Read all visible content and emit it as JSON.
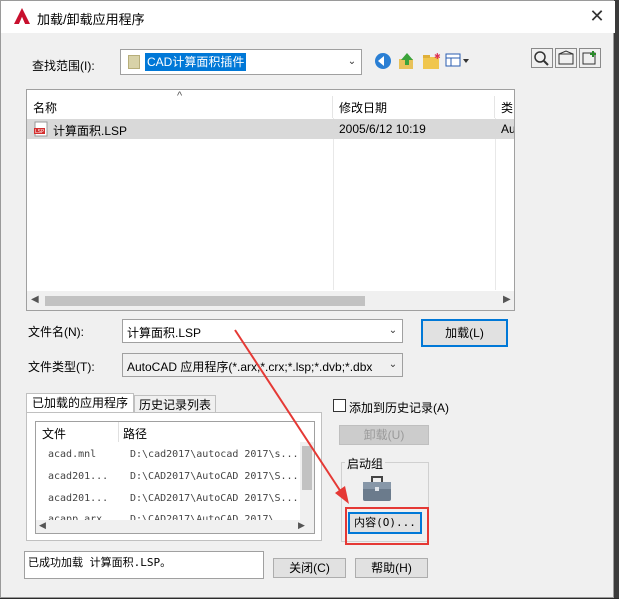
{
  "dialog": {
    "title": "加载/卸载应用程序"
  },
  "lookin": {
    "label": "查找范围(I):",
    "value": "CAD计算面积插件"
  },
  "filelist": {
    "columns": [
      "名称",
      "修改日期",
      "类"
    ],
    "rows": [
      {
        "name": "计算面积.LSP",
        "date": "2005/6/12 10:19",
        "type": "Au"
      }
    ]
  },
  "filename": {
    "label": "文件名(N):",
    "value": "计算面积.LSP"
  },
  "filetype": {
    "label": "文件类型(T):",
    "value": "AutoCAD 应用程序(*.arx;*.crx;*.lsp;*.dvb;*.dbx"
  },
  "buttons": {
    "load": "加载(L)",
    "unload": "卸载(U)",
    "contents": "内容(O)...",
    "close": "关闭(C)",
    "help": "帮助(H)"
  },
  "tabs": [
    "已加载的应用程序",
    "历史记录列表"
  ],
  "loaded": {
    "columns": [
      "文件",
      "路径"
    ],
    "rows": [
      {
        "file": "acad.mnl",
        "path": "D:\\cad2017\\autocad 2017\\s..."
      },
      {
        "file": "acad201...",
        "path": "D:\\CAD2017\\AutoCAD 2017\\S..."
      },
      {
        "file": "acad201...",
        "path": "D:\\CAD2017\\AutoCAD 2017\\S..."
      },
      {
        "file": "acapp.arx",
        "path": "D:\\CAD2017\\AutoCAD 2017\\..."
      }
    ]
  },
  "history_checkbox": "添加到历史记录(A)",
  "startup_group": "启动组",
  "status": "已成功加载 计算面积.LSP。",
  "colors": {
    "accent": "#0078d7",
    "annotation": "#e53935",
    "selection": "#d9d9d9"
  }
}
